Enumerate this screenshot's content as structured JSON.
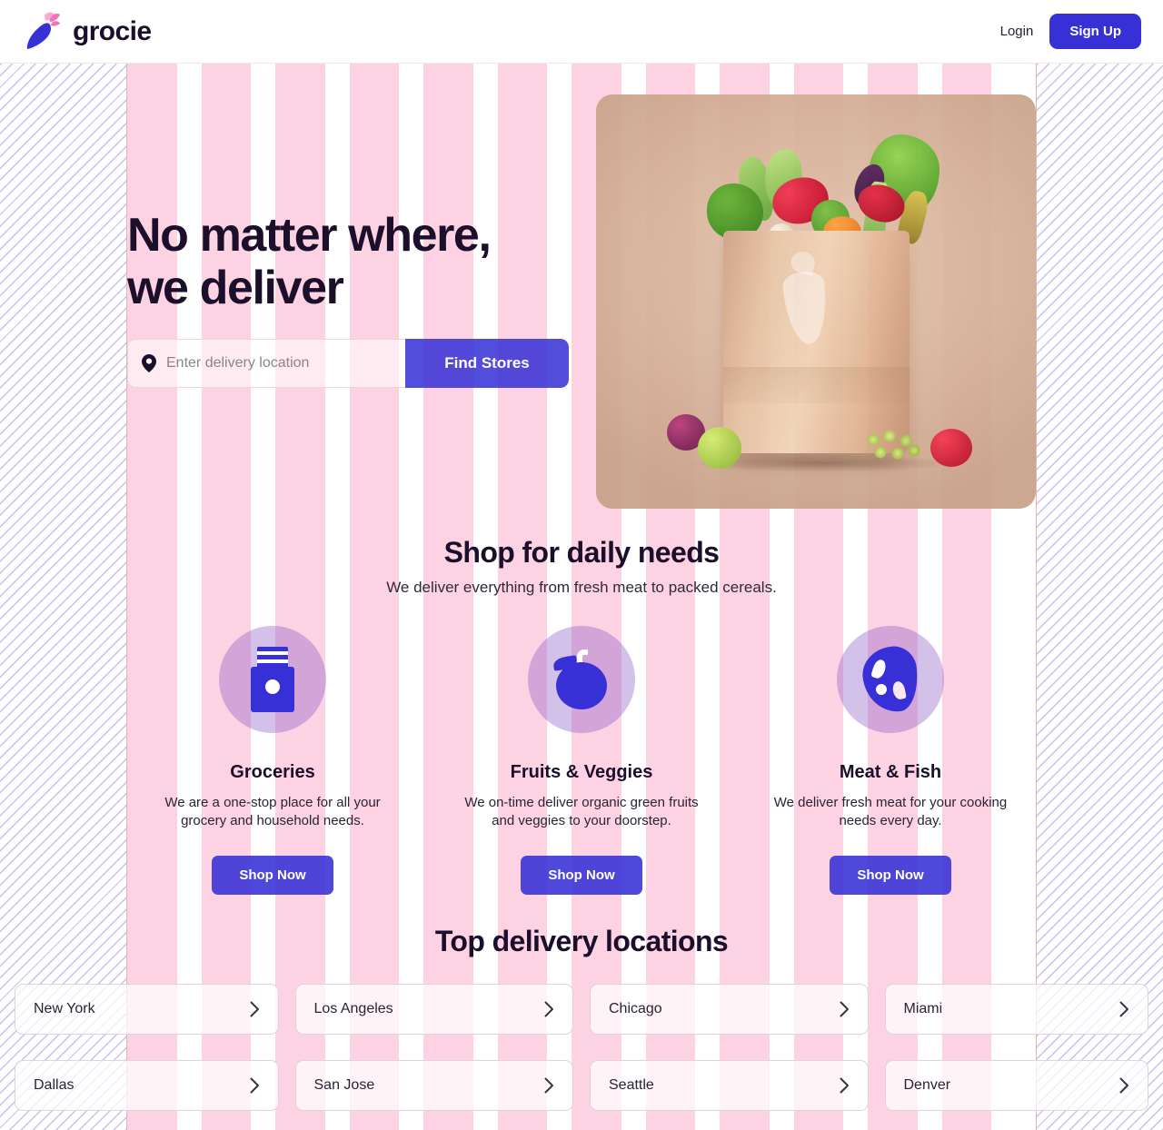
{
  "brand": {
    "name": "grocie",
    "logo_icon": "carrot-icon",
    "accent": "#3730d6",
    "leaf_color": "#f472b6"
  },
  "header": {
    "login_label": "Login",
    "signup_label": "Sign Up"
  },
  "hero": {
    "title": "No matter where,\nwe deliver",
    "search_placeholder": "Enter delivery location",
    "search_value": "",
    "pin_icon": "location-pin-icon",
    "find_label": "Find Stores",
    "image_alt": "grocery-bag-photo"
  },
  "needs": {
    "title": "Shop for daily needs",
    "subtitle": "We deliver everything from fresh meat to packed cereals.",
    "cards": [
      {
        "icon": "milk-carton-icon",
        "title": "Groceries",
        "desc": "We are a one-stop place for all your grocery and household needs.",
        "button": "Shop Now"
      },
      {
        "icon": "apple-fruit-icon",
        "title": "Fruits & Veggies",
        "desc": "We on-time deliver organic green fruits and veggies to your doorstep.",
        "button": "Shop Now"
      },
      {
        "icon": "meat-cut-icon",
        "title": "Meat & Fish",
        "desc": "We deliver fresh meat for your cooking needs every day.",
        "button": "Shop Now"
      }
    ]
  },
  "locations": {
    "title": "Top delivery locations",
    "chevron_icon": "chevron-right-icon",
    "row1": [
      "New York",
      "Los Angeles",
      "Chicago",
      "Miami"
    ],
    "row2": [
      "Dallas",
      "San Jose",
      "Seattle",
      "Denver"
    ]
  },
  "grid_overlay": {
    "columns": 12,
    "column_color": "#fdd3e3",
    "margin_hatch_color": "#968ce6"
  }
}
